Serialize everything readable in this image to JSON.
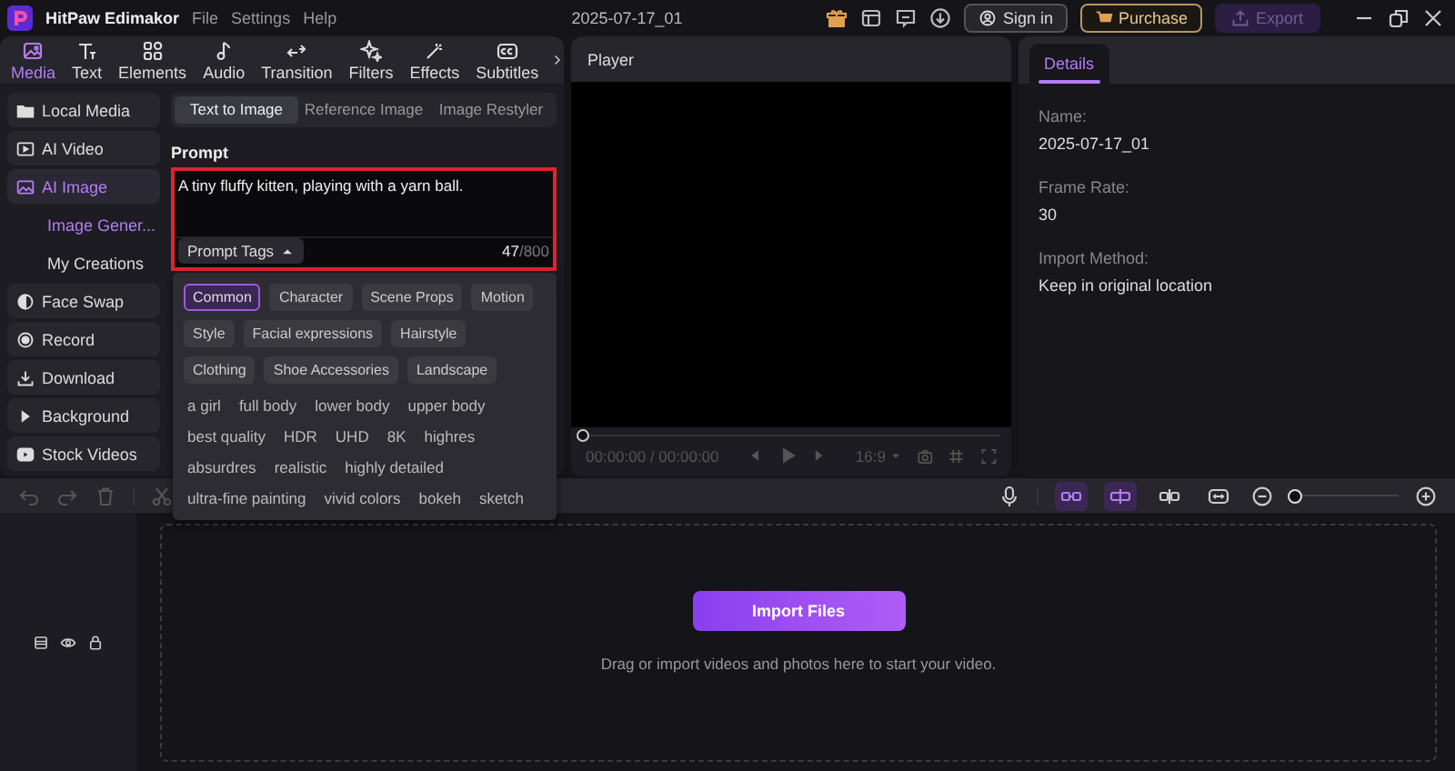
{
  "app": {
    "title": "HitPaw Edimakor",
    "menu": [
      "File",
      "Settings",
      "Help"
    ],
    "project": "2025-07-17_01",
    "sign_in": "Sign in",
    "purchase": "Purchase",
    "export": {
      "label": "Export",
      "disabled": true
    }
  },
  "toolbar_tabs": [
    {
      "kind": "media",
      "label": "Media",
      "selected": true
    },
    {
      "kind": "text",
      "label": "Text",
      "selected": false
    },
    {
      "kind": "elements",
      "label": "Elements",
      "selected": false
    },
    {
      "kind": "audio",
      "label": "Audio",
      "selected": false
    },
    {
      "kind": "transition",
      "label": "Transition",
      "selected": false
    },
    {
      "kind": "filters",
      "label": "Filters",
      "selected": false
    },
    {
      "kind": "effects",
      "label": "Effects",
      "selected": false
    },
    {
      "kind": "subtitles",
      "label": "Subtitles",
      "selected": false
    }
  ],
  "sidebar": {
    "items": [
      {
        "kind": "folder",
        "label": "Local Media",
        "selected": false
      },
      {
        "kind": "video",
        "label": "AI Video",
        "selected": false
      },
      {
        "kind": "image",
        "label": "AI Image",
        "selected": true,
        "children": [
          {
            "label": "Image Gener...",
            "selected": true
          },
          {
            "label": "My Creations",
            "selected": false
          }
        ]
      },
      {
        "kind": "face",
        "label": "Face Swap",
        "selected": false
      },
      {
        "kind": "record",
        "label": "Record",
        "selected": false
      },
      {
        "kind": "download",
        "label": "Download",
        "selected": false
      },
      {
        "kind": "background",
        "label": "Background",
        "selected": false
      },
      {
        "kind": "stock",
        "label": "Stock Videos",
        "selected": false
      }
    ]
  },
  "mode_tabs": [
    {
      "label": "Text to Image",
      "selected": true
    },
    {
      "label": "Reference Image",
      "selected": false
    },
    {
      "label": "Image Restyler",
      "selected": false
    }
  ],
  "prompt": {
    "label": "Prompt",
    "value": "A tiny fluffy kitten, playing with a yarn ball.",
    "tags_button": "Prompt Tags",
    "tags_expanded": true,
    "count": "47",
    "limit": "/800"
  },
  "tag_categories": [
    {
      "label": "Common",
      "selected": true
    },
    {
      "label": "Character",
      "selected": false
    },
    {
      "label": "Scene Props",
      "selected": false
    },
    {
      "label": "Motion",
      "selected": false
    },
    {
      "label": "Style",
      "selected": false
    },
    {
      "label": "Facial expressions",
      "selected": false
    },
    {
      "label": "Hairstyle",
      "selected": false
    },
    {
      "label": "Clothing",
      "selected": false
    },
    {
      "label": "Shoe Accessories",
      "selected": false
    },
    {
      "label": "Landscape",
      "selected": false
    }
  ],
  "tag_rows": [
    [
      "a girl",
      "full body",
      "lower body",
      "upper body"
    ],
    [
      "best quality",
      "HDR",
      "UHD",
      "8K",
      "highres"
    ],
    [
      "absurdres",
      "realistic",
      "highly detailed"
    ],
    [
      "ultra-fine painting",
      "vivid colors",
      "bokeh",
      "sketch"
    ]
  ],
  "player": {
    "title": "Player",
    "level": 0,
    "time": "00:00:00 / 00:00:00",
    "ratio": "16:9"
  },
  "details": {
    "tab": "Details",
    "fields": [
      {
        "label": "Name:",
        "value": "2025-07-17_01"
      },
      {
        "label": "Frame Rate:",
        "value": "30"
      },
      {
        "label": "Import Method:",
        "value": "Keep in original location"
      }
    ]
  },
  "timeline": {
    "tools": [
      {
        "kind": "link",
        "on": true
      },
      {
        "kind": "split",
        "on": true
      },
      {
        "kind": "detach",
        "on": false
      },
      {
        "kind": "fit",
        "on": false
      }
    ],
    "zoom": {
      "level": 0.05
    },
    "import_button": "Import Files",
    "hint": "Drag or import videos and photos here to start your video."
  }
}
